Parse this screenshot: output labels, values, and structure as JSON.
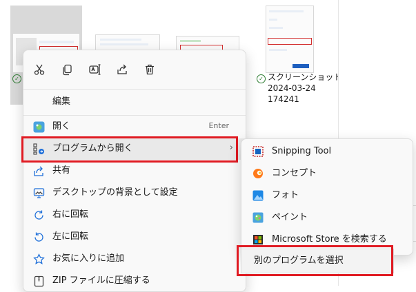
{
  "files": [
    {
      "name": "スクリーンショット",
      "date": "2024-03-24",
      "time": "174241"
    }
  ],
  "context_menu": {
    "toolbar": [
      {
        "icon": "scissors-icon",
        "label": "cut"
      },
      {
        "icon": "copy-icon",
        "label": "copy"
      },
      {
        "icon": "rename-icon",
        "label": "rename"
      },
      {
        "icon": "share-icon",
        "label": "share"
      },
      {
        "icon": "trash-icon",
        "label": "delete"
      }
    ],
    "edit_label": "編集",
    "items": [
      {
        "label": "開く",
        "accelerator": "Enter",
        "icon": "photo-app-icon"
      },
      {
        "label": "プログラムから開く",
        "icon": "open-with-icon"
      },
      {
        "label": "共有",
        "icon": "share-icon"
      },
      {
        "label": "デスクトップの背景として設定",
        "icon": "desktop-background-icon"
      },
      {
        "label": "右に回転",
        "icon": "rotate-right-icon"
      },
      {
        "label": "左に回転",
        "icon": "rotate-left-icon"
      },
      {
        "label": "お気に入りに追加",
        "icon": "star-icon"
      },
      {
        "label": "ZIP ファイルに圧縮する",
        "icon": "zip-icon"
      }
    ]
  },
  "open_with_submenu": {
    "items": [
      {
        "label": "Snipping Tool",
        "icon": "snipping-tool-icon"
      },
      {
        "label": "コンセプト",
        "icon": "concepts-icon"
      },
      {
        "label": "フォト",
        "icon": "photos-icon"
      },
      {
        "label": "ペイント",
        "icon": "paint-icon"
      },
      {
        "label": "Microsoft Store を検索する",
        "icon": "store-icon"
      }
    ],
    "other_app_label": "別のプログラムを選択"
  },
  "colors": {
    "highlight_frame": "#e01a22",
    "menu_bg": "#f9f9f9",
    "hover_bg": "#e9e9e9"
  }
}
